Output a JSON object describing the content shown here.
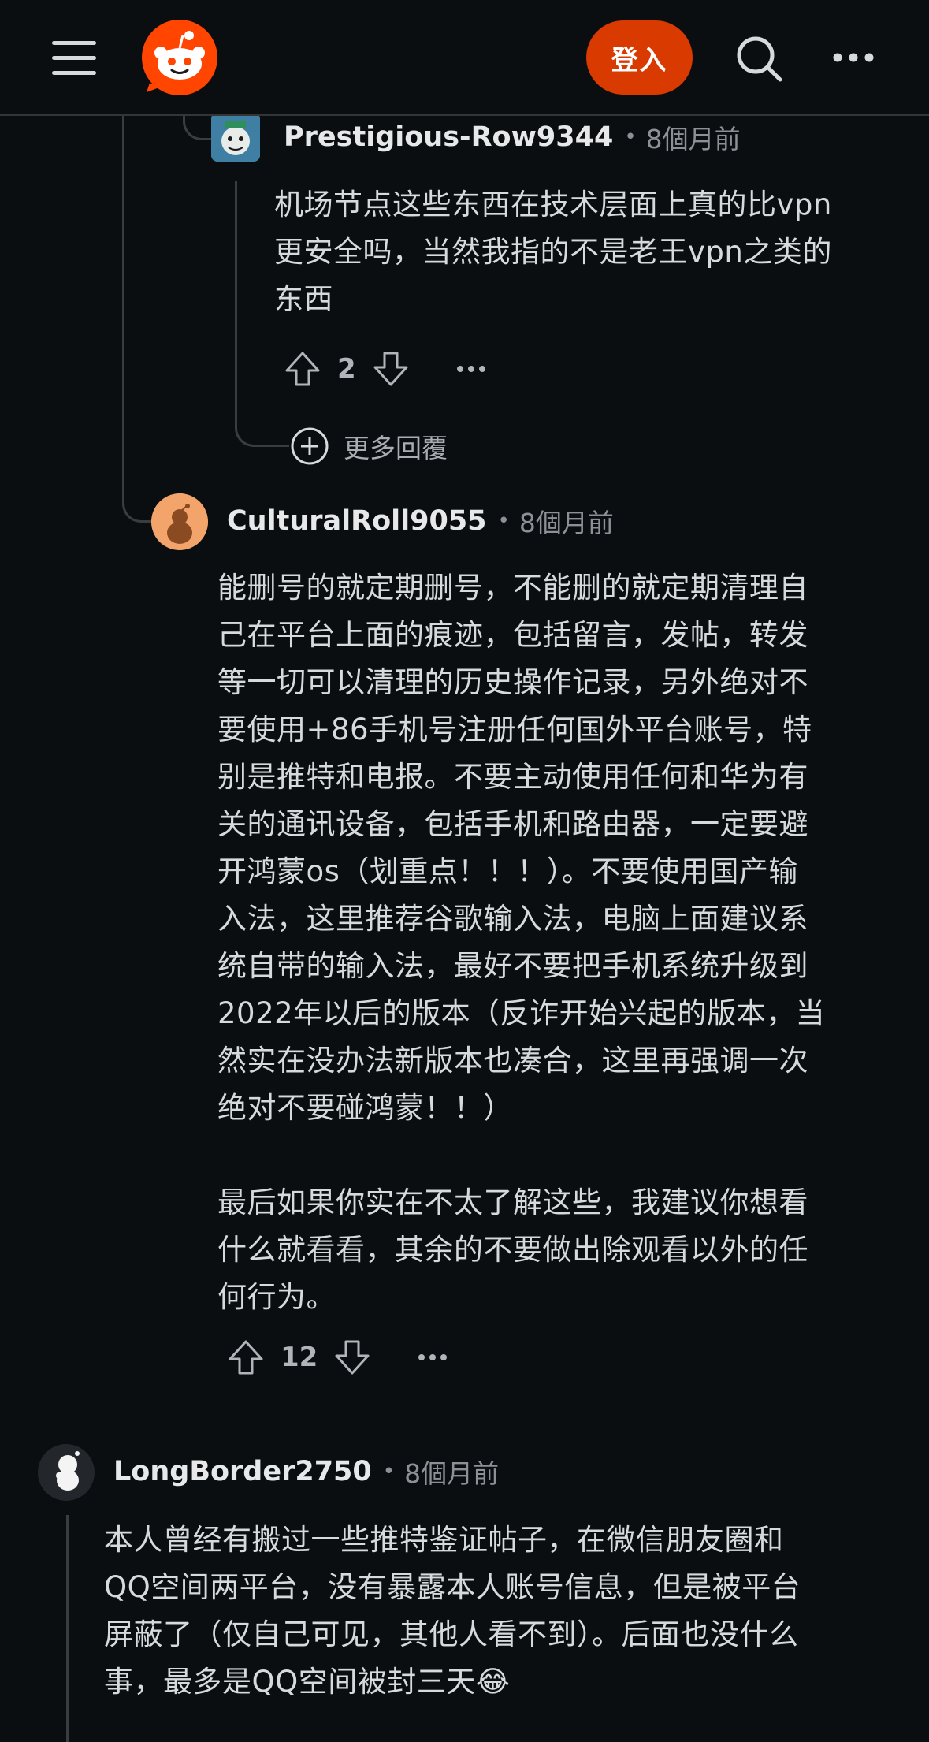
{
  "header": {
    "login_label": "登入",
    "logo_icon": "reddit-logo-icon",
    "menu_icon": "hamburger-menu-icon",
    "search_icon": "search-icon",
    "more_icon": "more-horizontal-icon",
    "accent_color": "#d93a00"
  },
  "comments": [
    {
      "username": "Prestigious-Row9344",
      "separator": "•",
      "time": "8個月前",
      "body": "机场节点这些东西在技术层面上真的比vpn\n更安全吗，当然我指的不是老王vpn之类的\n东西",
      "score": "2",
      "more_replies_label": "更多回覆"
    },
    {
      "username": "CulturalRoll9055",
      "separator": "•",
      "time": "8個月前",
      "body": "能删号的就定期删号，不能删的就定期清理自\n己在平台上面的痕迹，包括留言，发帖，转发\n等一切可以清理的历史操作记录，另外绝对不\n要使用+86手机号注册任何国外平台账号，特\n别是推特和电报。不要主动使用任何和华为有\n关的通讯设备，包括手机和路由器，一定要避\n开鸿蒙os（划重点！！！）。不要使用国产输\n入法，这里推荐谷歌输入法，电脑上面建议系\n统自带的输入法，最好不要把手机系统升级到\n2022年以后的版本（反诈开始兴起的版本，当\n然实在没办法新版本也凑合，这里再强调一次\n绝对不要碰鸿蒙！！）\n\n最后如果你实在不太了解这些，我建议你想看\n什么就看看，其余的不要做出除观看以外的任\n何行为。",
      "score": "12"
    },
    {
      "username": "LongBorder2750",
      "separator": "•",
      "time": "8個月前",
      "body": "本人曾经有搬过一些推特鉴证帖子，在微信朋友圈和\nQQ空间两平台，没有暴露本人账号信息，但是被平台\n屏蔽了（仅自己可见，其他人看不到）。后面也没什么\n事，最多是QQ空间被封三天😂"
    }
  ]
}
